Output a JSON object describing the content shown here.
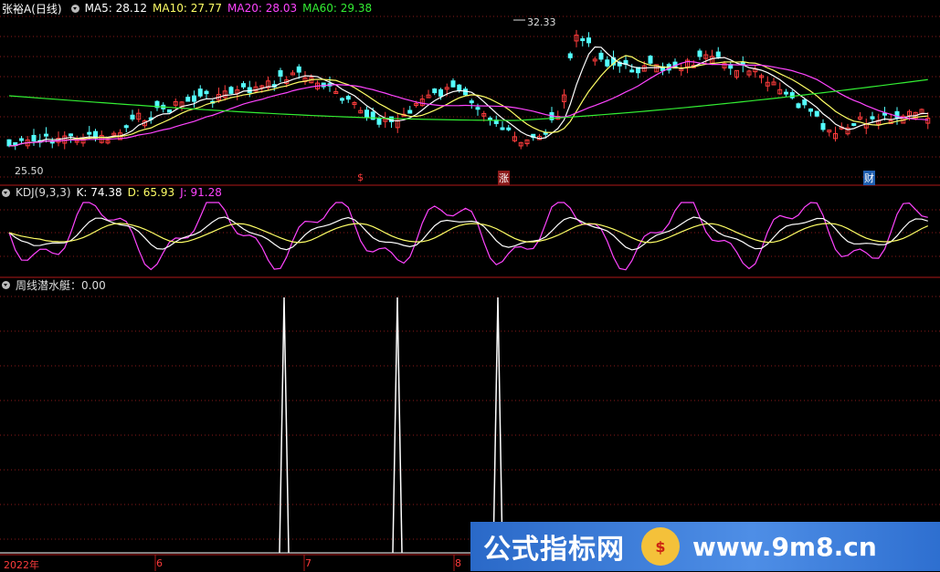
{
  "header": {
    "stock": "张裕A(日线)",
    "ma5": "MA5: 28.12",
    "ma10": "MA10: 27.77",
    "ma20": "MA20: 28.03",
    "ma60": "MA60: 29.38"
  },
  "main_chart": {
    "high_label": "32.33",
    "low_label": "25.50",
    "markers": [
      "$",
      "涨",
      "财"
    ]
  },
  "kdj": {
    "name": "KDJ(9,3,3)",
    "k": "K: 74.38",
    "d": "D: 65.93",
    "j": "J: 91.28"
  },
  "indicator": {
    "name": "周线潜水艇：0.00"
  },
  "x_axis": [
    "2022年",
    "6",
    "7",
    "8"
  ],
  "watermark": {
    "title": "公式指标网",
    "logo": "$",
    "url": "www.9m8.cn"
  },
  "colors": {
    "up": "#ff3c3c",
    "down": "#54ffff",
    "ma5": "#ffffff",
    "ma10": "#ffff66",
    "ma20": "#ff44ff",
    "ma60": "#33ee33",
    "grid": "#8b1a1a"
  }
}
